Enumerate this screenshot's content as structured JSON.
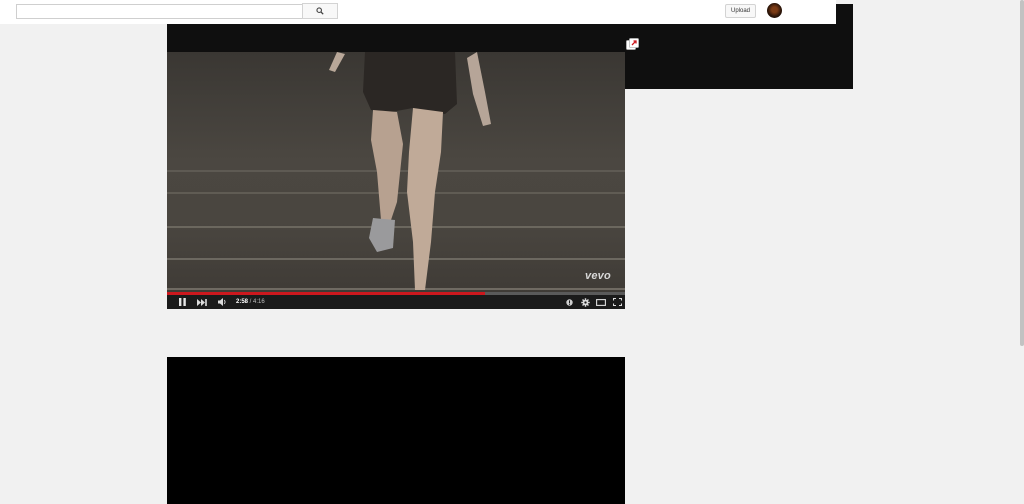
{
  "masthead": {
    "search_placeholder": "",
    "search_value": "",
    "upload_label": "Upload"
  },
  "player": {
    "watermark": "vevo",
    "time_current": "2:58",
    "time_separator": " / ",
    "time_total": "4:16",
    "progress_fraction": 0.695,
    "icons": {
      "play_pause": "pause-icon",
      "next": "next-icon",
      "volume": "volume-icon",
      "annotations": "annotations-icon",
      "settings": "gear-icon",
      "theater": "theater-mode-icon",
      "fullscreen": "fullscreen-icon",
      "popout": "popout-icon"
    }
  },
  "colors": {
    "progress": "#cc181e",
    "player_background": "#0f0f0f",
    "page_background": "#f1f1f1"
  }
}
